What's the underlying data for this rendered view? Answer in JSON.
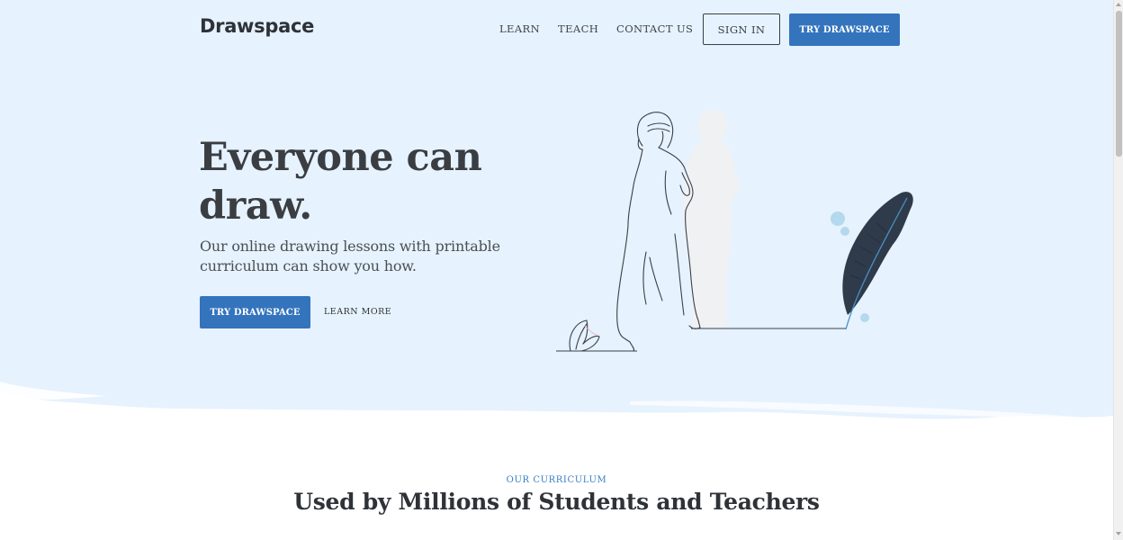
{
  "colors": {
    "hero_background": "#e6f2fd",
    "accent": "#3374bd",
    "eyebrow": "#3a7fc4",
    "text_dark": "#3a3d42"
  },
  "nav": {
    "logo": "Drawspace",
    "links": [
      "LEARN",
      "TEACH",
      "CONTACT US"
    ],
    "sign_in_label": "SIGN IN",
    "try_label": "TRY DRAWSPACE"
  },
  "hero": {
    "title": "Everyone can draw.",
    "subtitle": "Our online drawing lessons with printable curriculum can show you how.",
    "try_label": "TRY DRAWSPACE",
    "learn_more_label": "LEARN MORE",
    "illustration": "woman-outline-with-shadow-and-feather-quill"
  },
  "curriculum": {
    "eyebrow": "OUR CURRICULUM",
    "title": "Used by Millions of Students and Teachers"
  }
}
